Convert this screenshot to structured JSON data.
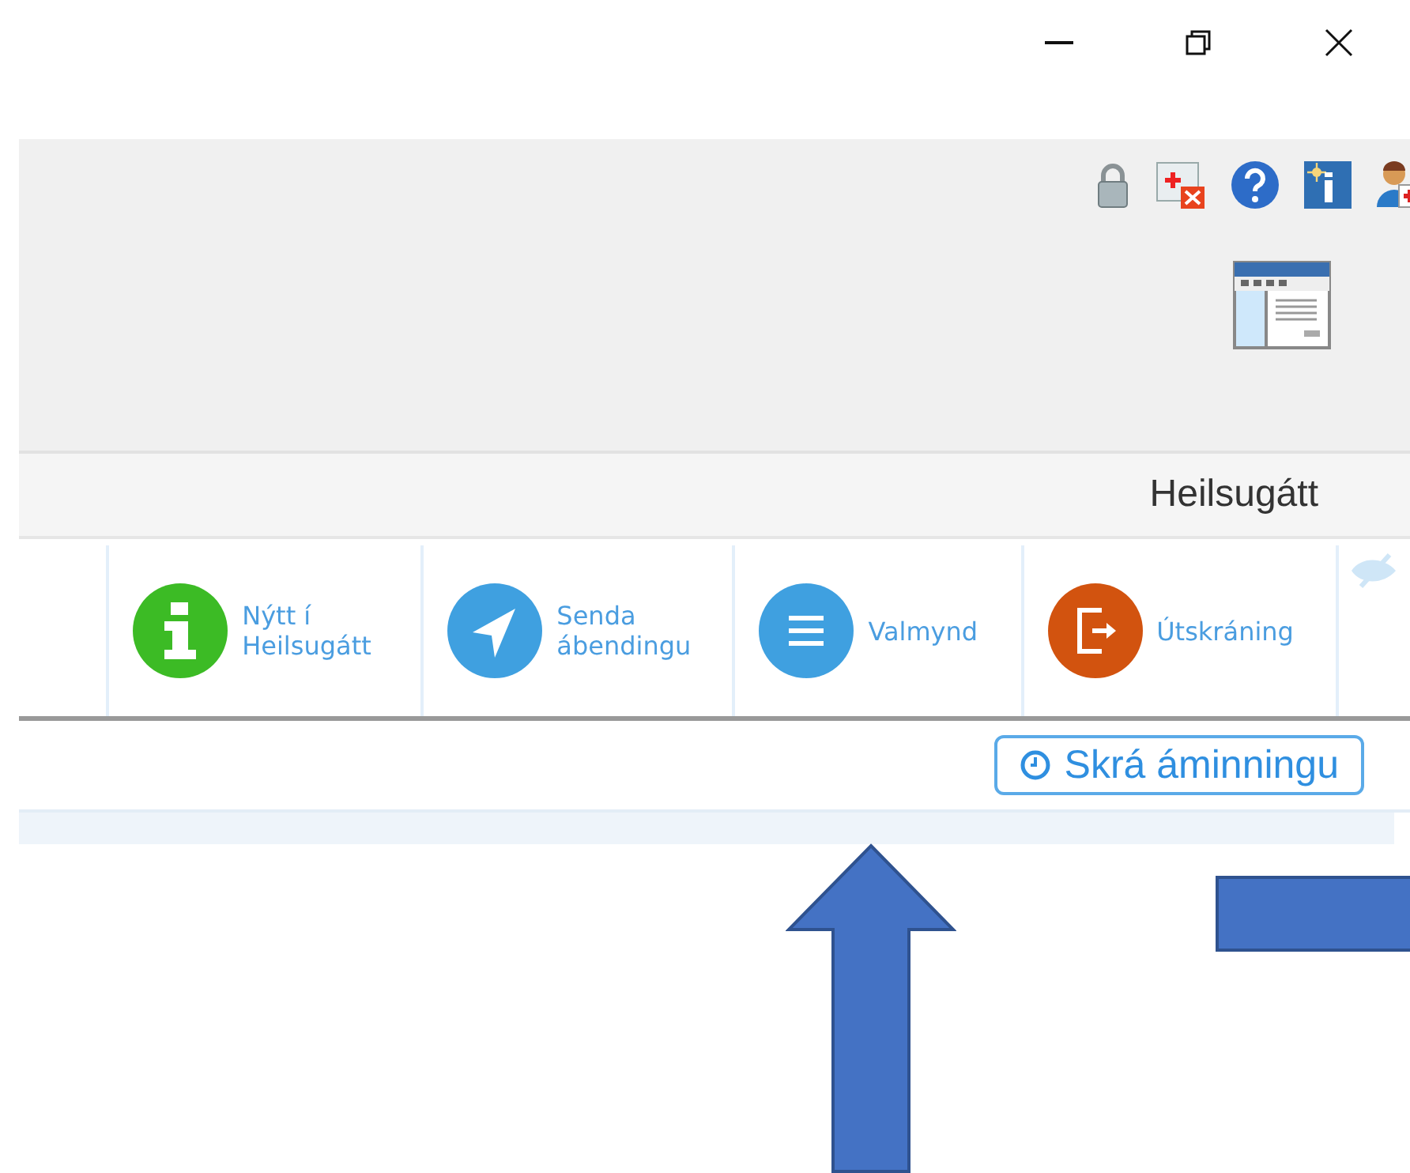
{
  "window": {
    "controls": [
      {
        "kind": "minimize"
      },
      {
        "kind": "maximize"
      },
      {
        "kind": "close"
      }
    ]
  },
  "header_icons": [
    {
      "kind": "lock"
    },
    {
      "kind": "window-remove"
    },
    {
      "kind": "help"
    },
    {
      "kind": "info"
    },
    {
      "kind": "user-add"
    }
  ],
  "header_title": "Heilsugátt",
  "toolbar": [
    {
      "kind": "info",
      "label": "Nýtt í Heilsugátt"
    },
    {
      "kind": "send",
      "label": "Senda ábendingu"
    },
    {
      "kind": "menu",
      "label": "Valmynd"
    },
    {
      "kind": "logout",
      "label": "Útskráning"
    }
  ],
  "reminder_button": {
    "label": "Skrá áminningu"
  }
}
